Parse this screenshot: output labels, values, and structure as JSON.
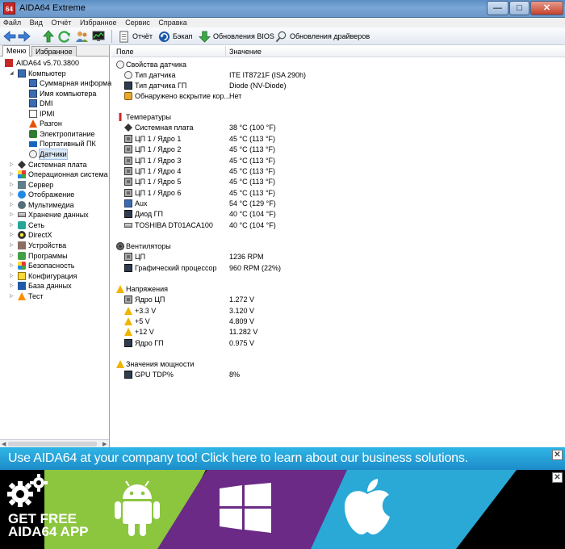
{
  "window": {
    "title": "AIDA64 Extreme",
    "app_icon_text": "64",
    "minimize_label": "—",
    "maximize_label": "□",
    "close_label": "✕"
  },
  "menu": [
    "Файл",
    "Вид",
    "Отчёт",
    "Избранное",
    "Сервис",
    "Справка"
  ],
  "toolbar": {
    "report_label": "Отчёт",
    "backup_label": "Бэкап",
    "bios_label": "Обновления BIOS",
    "drivers_label": "Обновления драйверов"
  },
  "left_tabs": [
    "Меню",
    "Избранное"
  ],
  "tree": {
    "root": "AIDA64 v5.70.3800",
    "computer": "Компьютер",
    "computer_children": [
      "Суммарная информа",
      "Имя компьютера",
      "DMI",
      "IPMI",
      "Разгон",
      "Электропитание",
      "Портативный ПК",
      "Датчики"
    ],
    "top_level": [
      "Системная плата",
      "Операционная система",
      "Сервер",
      "Отображение",
      "Мультимедиа",
      "Хранение данных",
      "Сеть",
      "DirectX",
      "Устройства",
      "Программы",
      "Безопасность",
      "Конфигурация",
      "База данных",
      "Тест"
    ]
  },
  "columns": {
    "field": "Поле",
    "value": "Значение"
  },
  "sections": {
    "sensor_props": {
      "title": "Свойства датчика",
      "rows": [
        {
          "field": "Тип датчика",
          "value": "ITE IT8721F  (ISA 290h)"
        },
        {
          "field": "Тип датчика ГП",
          "value": "Diode  (NV-Diode)"
        },
        {
          "field": "Обнаружено вскрытие кор...",
          "value": "Нет"
        }
      ]
    },
    "temps": {
      "title": "Температуры",
      "rows": [
        {
          "field": "Системная плата",
          "value": "38 °C  (100 °F)"
        },
        {
          "field": "ЦП 1 / Ядро 1",
          "value": "45 °C  (113 °F)"
        },
        {
          "field": "ЦП 1 / Ядро 2",
          "value": "45 °C  (113 °F)"
        },
        {
          "field": "ЦП 1 / Ядро 3",
          "value": "45 °C  (113 °F)"
        },
        {
          "field": "ЦП 1 / Ядро 4",
          "value": "45 °C  (113 °F)"
        },
        {
          "field": "ЦП 1 / Ядро 5",
          "value": "45 °C  (113 °F)"
        },
        {
          "field": "ЦП 1 / Ядро 6",
          "value": "45 °C  (113 °F)"
        },
        {
          "field": "Aux",
          "value": "54 °C  (129 °F)"
        },
        {
          "field": "Диод ГП",
          "value": "40 °C  (104 °F)"
        },
        {
          "field": "TOSHIBA DT01ACA100",
          "value": "40 °C  (104 °F)"
        }
      ]
    },
    "fans": {
      "title": "Вентиляторы",
      "rows": [
        {
          "field": "ЦП",
          "value": "1236 RPM"
        },
        {
          "field": "Графический процессор",
          "value": "960 RPM  (22%)"
        }
      ]
    },
    "volts": {
      "title": "Напряжения",
      "rows": [
        {
          "field": "Ядро ЦП",
          "value": "1.272 V"
        },
        {
          "field": "+3.3 V",
          "value": "3.120 V"
        },
        {
          "field": "+5 V",
          "value": "4.809 V"
        },
        {
          "field": "+12 V",
          "value": "11.282 V"
        },
        {
          "field": "Ядро ГП",
          "value": "0.975 V"
        }
      ]
    },
    "power": {
      "title": "Значения мощности",
      "rows": [
        {
          "field": "GPU TDP%",
          "value": "8%"
        }
      ]
    }
  },
  "banner": {
    "text": "Use AIDA64 at your company too! Click here to learn about our business solutions.",
    "get_free_line1": "GET FREE",
    "get_free_line2": "AIDA64 APP",
    "close_label": "✕",
    "colors": {
      "green": "#8cc63f",
      "purple": "#6a2a86",
      "cyan": "#2aa9d6",
      "blue_bar": "#1d8cc9"
    }
  }
}
